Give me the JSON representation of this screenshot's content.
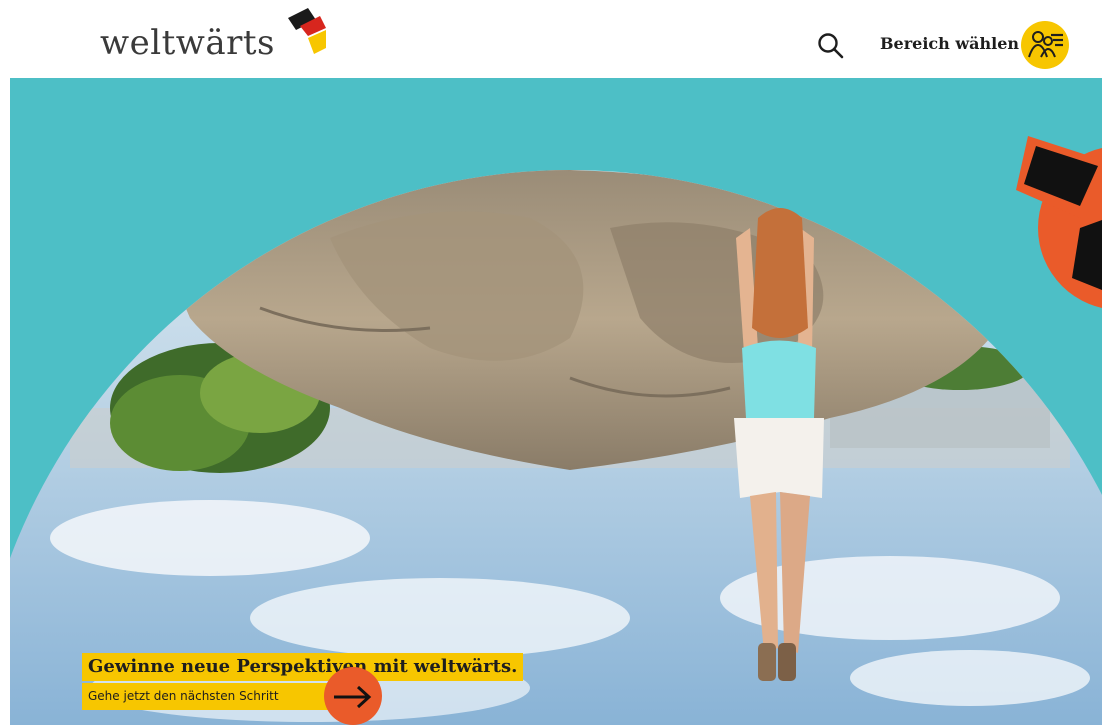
{
  "header": {
    "logo": {
      "part1": "welt",
      "part2": "wärts"
    },
    "area_select_label": "Bereich wählen"
  },
  "icons": {
    "search": "magnifier-icon",
    "area": "people-group-menu-icon",
    "arrow": "arrow-right-icon",
    "logo_mark": "folded-flag-icon"
  },
  "colors": {
    "accent_yellow": "#f7c600",
    "hero_teal": "#4dbfc6",
    "accent_orange": "#ea5b2a",
    "text_dark": "#1e1e1e"
  },
  "hero": {
    "headline": "Gewinne neue Perspektiven mit weltwärts.",
    "cta_label": "Gehe jetzt den nächsten Schritt"
  }
}
